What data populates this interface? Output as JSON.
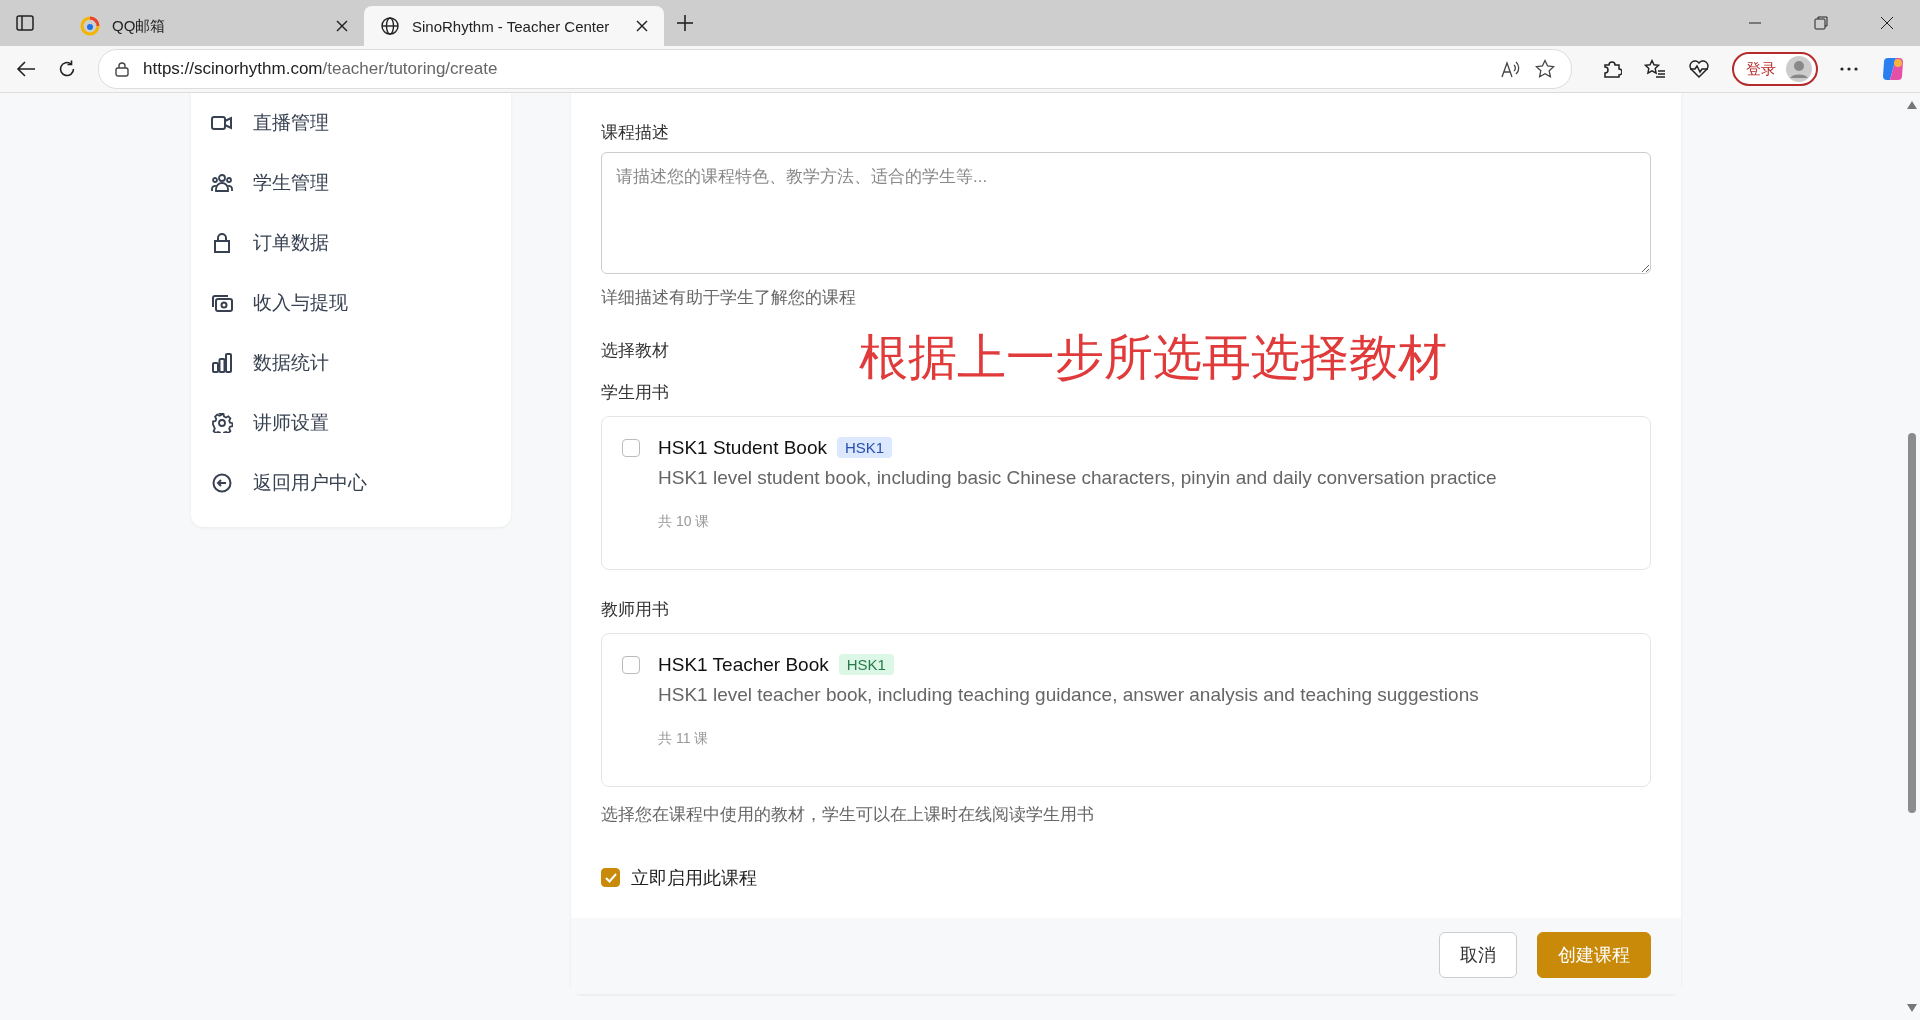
{
  "browser": {
    "tabs": [
      {
        "title": "QQ邮箱",
        "selected": false
      },
      {
        "title": "SinoRhythm - Teacher Center",
        "selected": true
      }
    ],
    "url": {
      "host": "https://scinorhythm.com",
      "path": "/teacher/tutoring/create"
    },
    "login_label": "登录"
  },
  "sidebar": {
    "items": [
      {
        "label": "直播管理"
      },
      {
        "label": "学生管理"
      },
      {
        "label": "订单数据"
      },
      {
        "label": "收入与提现"
      },
      {
        "label": "数据统计"
      },
      {
        "label": "讲师设置"
      },
      {
        "label": "返回用户中心"
      }
    ]
  },
  "form": {
    "description": {
      "label": "课程描述",
      "placeholder": "请描述您的课程特色、教学方法、适合的学生等...",
      "hint": "详细描述有助于学生了解您的课程"
    },
    "materials_label": "选择教材",
    "annotation": "根据上一步所选再选择教材",
    "groups": [
      {
        "label": "学生用书",
        "books": [
          {
            "title": "HSK1 Student Book",
            "tag": "HSK1",
            "color": "#dbe8fd",
            "checked": false,
            "description": "HSK1 level student book, including basic Chinese characters, pinyin and daily conversation practice",
            "lessons": "共 10 课"
          }
        ]
      },
      {
        "label": "教师用书",
        "books": [
          {
            "title": "HSK1 Teacher Book",
            "tag": "HSK1",
            "color": "#dcf7e6",
            "checked": false,
            "description": "HSK1 level teacher book, including teaching guidance, answer analysis and teaching suggestions",
            "lessons": "共 11 课"
          }
        ]
      }
    ],
    "materials_hint": "选择您在课程中使用的教材，学生可以在上课时在线阅读学生用书",
    "enable": {
      "label": "立即启用此课程",
      "checked": true
    },
    "buttons": [
      {
        "label": "取消",
        "kind": "secondary"
      },
      {
        "label": "创建课程",
        "kind": "primary"
      }
    ]
  }
}
